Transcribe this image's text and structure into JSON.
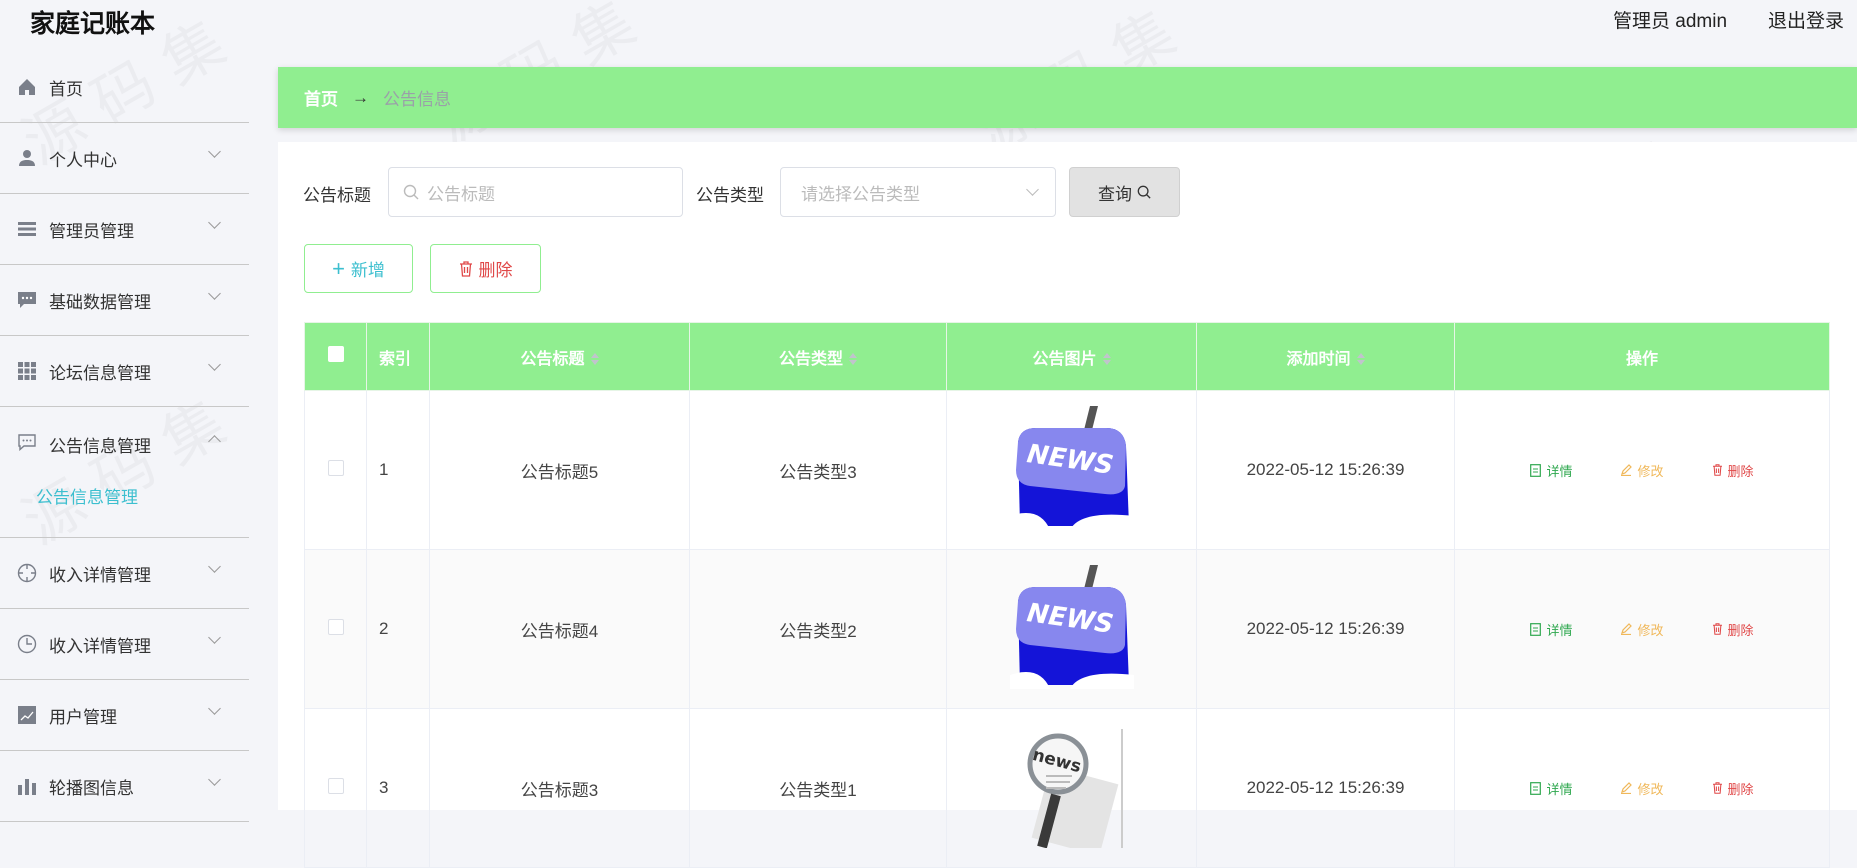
{
  "header": {
    "title": "家庭记账本",
    "user": "管理员 admin",
    "logout": "退出登录"
  },
  "sidebar": {
    "items": [
      {
        "label": "首页",
        "icon": "home-icon"
      },
      {
        "label": "个人中心",
        "icon": "user-icon"
      },
      {
        "label": "管理员管理",
        "icon": "list-icon"
      },
      {
        "label": "基础数据管理",
        "icon": "message-icon"
      },
      {
        "label": "论坛信息管理",
        "icon": "grid-icon"
      },
      {
        "label": "公告信息管理",
        "icon": "chat-icon",
        "expanded": true,
        "sub": "公告信息管理"
      },
      {
        "label": "收入详情管理",
        "icon": "crosshair-icon"
      },
      {
        "label": "收入详情管理",
        "icon": "clock-icon"
      },
      {
        "label": "用户管理",
        "icon": "chart-line-icon"
      },
      {
        "label": "轮播图信息",
        "icon": "bar-chart-icon"
      }
    ]
  },
  "breadcrumb": {
    "home": "首页",
    "arrow": "→",
    "current": "公告信息"
  },
  "search": {
    "title_label": "公告标题",
    "title_placeholder": "公告标题",
    "type_label": "公告类型",
    "type_placeholder": "请选择公告类型",
    "query": "查询"
  },
  "actions": {
    "add": "新增",
    "delete": "删除"
  },
  "table": {
    "headers": [
      "索引",
      "公告标题",
      "公告类型",
      "公告图片",
      "添加时间",
      "操作"
    ],
    "rows": [
      {
        "index": "1",
        "title": "公告标题5",
        "type": "公告类型3",
        "time": "2022-05-12 15:26:39",
        "image": "news-key"
      },
      {
        "index": "2",
        "title": "公告标题4",
        "type": "公告类型2",
        "time": "2022-05-12 15:26:39",
        "image": "news-key"
      },
      {
        "index": "3",
        "title": "公告标题3",
        "type": "公告类型1",
        "time": "2022-05-12 15:26:39",
        "image": "news-magnifier"
      }
    ],
    "ops": {
      "detail": "详情",
      "edit": "修改",
      "delete": "删除"
    }
  },
  "colors": {
    "accent": "#90ee90",
    "teal": "#3cbfcf",
    "detail": "#2fa84f",
    "edit": "#f0b85a",
    "delete": "#e04848"
  },
  "watermark": "源码集"
}
